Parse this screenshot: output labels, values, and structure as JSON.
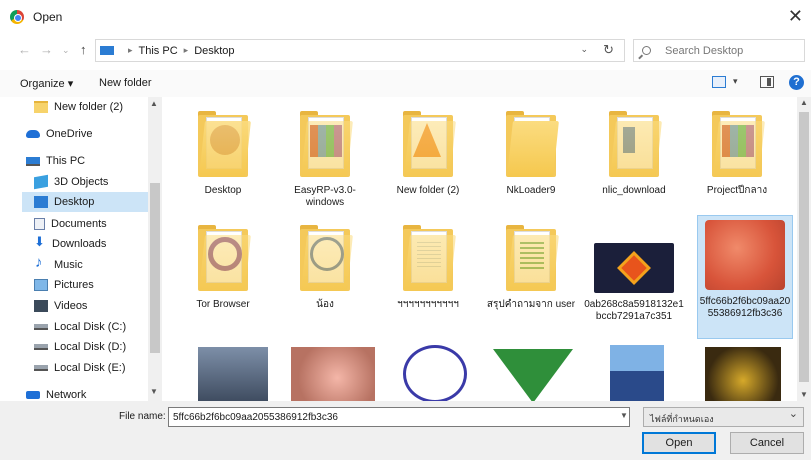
{
  "window": {
    "title": "Open"
  },
  "nav": {
    "back": "←",
    "forward": "→",
    "up": "↑"
  },
  "address": {
    "crumbs": [
      "This PC",
      "Desktop"
    ],
    "refresh": "↻"
  },
  "search": {
    "placeholder": "Search Desktop"
  },
  "toolbar": {
    "organize": "Organize ▾",
    "new_folder": "New folder",
    "help": "?"
  },
  "sidebar": {
    "items": [
      {
        "label": "New folder (2)",
        "icon": "folder-icon"
      },
      {
        "label": "OneDrive",
        "icon": "cloud-icon"
      },
      {
        "label": "This PC",
        "icon": "computer-icon"
      },
      {
        "label": "3D Objects",
        "icon": "cube-icon"
      },
      {
        "label": "Desktop",
        "icon": "desktop-icon",
        "selected": true
      },
      {
        "label": "Documents",
        "icon": "document-icon"
      },
      {
        "label": "Downloads",
        "icon": "download-icon"
      },
      {
        "label": "Music",
        "icon": "music-icon"
      },
      {
        "label": "Pictures",
        "icon": "picture-icon"
      },
      {
        "label": "Videos",
        "icon": "video-icon"
      },
      {
        "label": "Local Disk (C:)",
        "icon": "drive-icon"
      },
      {
        "label": "Local Disk (D:)",
        "icon": "drive-icon"
      },
      {
        "label": "Local Disk (E:)",
        "icon": "drive-icon"
      },
      {
        "label": "Network",
        "icon": "network-icon"
      }
    ]
  },
  "files": [
    {
      "name": "Desktop",
      "kind": "folder"
    },
    {
      "name": "EasyRP-v3.0-windows",
      "kind": "folder"
    },
    {
      "name": "New folder (2)",
      "kind": "folder"
    },
    {
      "name": "NkLoader9",
      "kind": "folder"
    },
    {
      "name": "nlic_download",
      "kind": "folder"
    },
    {
      "name": "Projectปีกลาง",
      "kind": "folder"
    },
    {
      "name": "Tor Browser",
      "kind": "folder"
    },
    {
      "name": "น้อง",
      "kind": "folder"
    },
    {
      "name": "ฯฯฯฯฯฯฯฯฯฯฯ",
      "kind": "folder"
    },
    {
      "name": "สรุปคำถามจาก user",
      "kind": "folder"
    },
    {
      "name": "0ab268c8a5918132e1bccb7291a7c351",
      "kind": "image"
    },
    {
      "name": "5ffc66b2f6bc09aa2055386912fb3c36",
      "kind": "image",
      "selected": true
    },
    {
      "name": "",
      "kind": "image"
    },
    {
      "name": "",
      "kind": "image"
    },
    {
      "name": "",
      "kind": "image"
    },
    {
      "name": "",
      "kind": "image"
    },
    {
      "name": "",
      "kind": "image"
    },
    {
      "name": "",
      "kind": "image"
    }
  ],
  "footer": {
    "file_name_label": "File name:",
    "file_name_value": "5ffc66b2f6bc09aa2055386912fb3c36",
    "file_type": "ไฟล์ที่กำหนดเอง",
    "open_label": "Open",
    "cancel_label": "Cancel"
  },
  "colors": {
    "accent": "#0078d7",
    "selection": "#cce4f7",
    "folder": "#f4c95a"
  }
}
